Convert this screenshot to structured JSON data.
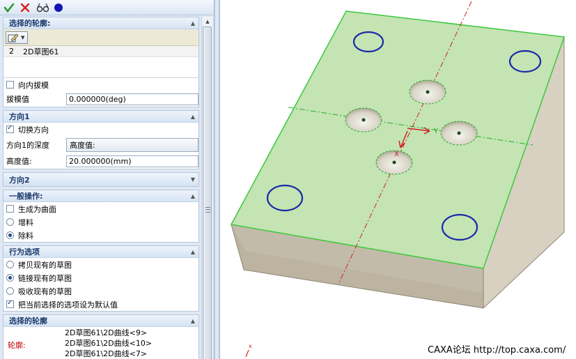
{
  "toolbar": {
    "ok_icon": "check-icon",
    "cancel_icon": "cross-icon",
    "preview_icon": "glasses-icon",
    "dot_icon": "blue-dot-icon"
  },
  "profile_section": {
    "title": "选择的轮廓:",
    "sketch_item": {
      "index": "2",
      "name": "2D草图61"
    },
    "draft_inward_label": "向内拔模",
    "draft_inward_checked": false,
    "draft_value_label": "拔模值",
    "draft_value": "0.000000(deg)"
  },
  "direction1": {
    "title": "方向1",
    "switch_label": "切换方向",
    "switch_checked": true,
    "depth_label": "方向1的深度",
    "depth_type": "高度值:",
    "height_label": "高度值:",
    "height_value": "20.000000(mm)"
  },
  "direction2": {
    "title": "方向2"
  },
  "general_ops": {
    "title": "一般操作:",
    "surface_label": "生成为曲面",
    "surface_checked": false,
    "add_label": "增料",
    "remove_label": "除料",
    "selected": "remove"
  },
  "behavior": {
    "title": "行为选项",
    "copy_label": "拷贝现有的草图",
    "link_label": "链接现有的草图",
    "absorb_label": "吸收现有的草图",
    "default_label": "把当前选择的选项设为默认值",
    "selected": "link",
    "default_checked": true
  },
  "contour_section": {
    "title": "选择的轮廓",
    "label": "轮廓:",
    "items": [
      "2D草图61\\2D曲线<9>",
      "2D草图61\\2D曲线<10>",
      "2D草图61\\2D曲线<7>"
    ]
  },
  "viewport": {
    "axis_y_label": "Y",
    "axis_x_label": "X",
    "origin_x_label": "x",
    "watermark": "CAXA论坛 http://top.caxa.com/",
    "colors": {
      "top_face": "#c4e4b4",
      "edge_green": "#3cc83c",
      "side_front": "#d6cfc0",
      "side_left": "#bdb5a4",
      "circle_blue": "#1a2aa8",
      "axis_red": "#d02020",
      "axis_green": "#20b020"
    }
  }
}
